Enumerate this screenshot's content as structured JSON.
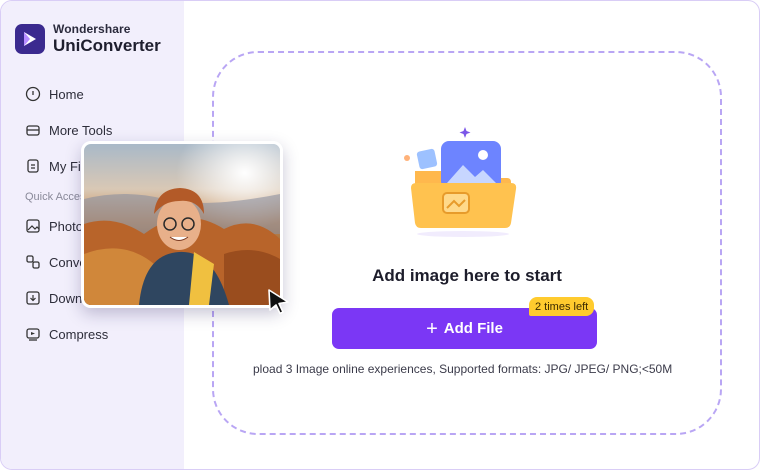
{
  "brand": {
    "top": "Wondershare",
    "name": "UniConverter"
  },
  "sidebar": {
    "items": [
      {
        "label": "Home",
        "icon": "home-icon"
      },
      {
        "label": "More Tools",
        "icon": "toolbox-icon"
      },
      {
        "label": "My Fil",
        "icon": "file-icon"
      },
      {
        "label": "Photo",
        "icon": "image-icon"
      },
      {
        "label": "Conve",
        "icon": "convert-icon"
      },
      {
        "label": "Down",
        "icon": "download-icon"
      },
      {
        "label": "Compress",
        "icon": "compress-icon"
      }
    ],
    "section_label": "Quick Acces"
  },
  "main": {
    "title": "Add image here to start",
    "add_button": "Add File",
    "badge": "2 times left",
    "support_text": "pload 3 Image online experiences, Supported formats: JPG/ JPEG/ PNG;<50M"
  },
  "colors": {
    "accent": "#7b37f5",
    "badge": "#ffcb2e",
    "sidebar_bg": "#f2effc",
    "dash": "#b9a6f4"
  }
}
